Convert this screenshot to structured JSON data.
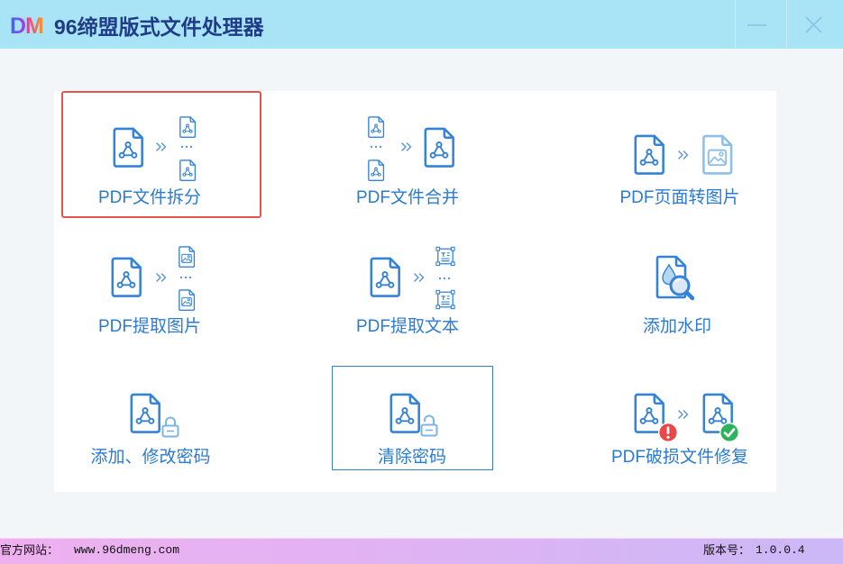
{
  "app": {
    "logo_text": "DM",
    "title": "96缔盟版式文件处理器"
  },
  "window_controls": {
    "minimize": "minimize-icon",
    "close": "close-icon"
  },
  "tools": [
    {
      "label": "PDF文件拆分",
      "icons": [
        "pdf-icon",
        "double-chevron-right-icon",
        "pdf-small-icon",
        "ellipsis-icon",
        "pdf-small-icon"
      ]
    },
    {
      "label": "PDF文件合并",
      "icons": [
        "pdf-small-icon",
        "ellipsis-icon",
        "pdf-small-icon",
        "double-chevron-right-icon",
        "pdf-icon"
      ]
    },
    {
      "label": "PDF页面转图片",
      "icons": [
        "pdf-icon",
        "double-chevron-right-icon",
        "image-file-icon"
      ]
    },
    {
      "label": "PDF提取图片",
      "icons": [
        "pdf-icon",
        "double-chevron-right-icon",
        "image-file-small-icon",
        "ellipsis-icon",
        "image-file-small-icon"
      ]
    },
    {
      "label": "PDF提取文本",
      "icons": [
        "pdf-icon",
        "double-chevron-right-icon",
        "text-block-icon",
        "ellipsis-icon",
        "text-block-icon"
      ]
    },
    {
      "label": "添加水印",
      "icons": [
        "watermark-magnifier-icon"
      ]
    },
    {
      "label": "添加、修改密码",
      "icons": [
        "pdf-icon",
        "lock-icon"
      ]
    },
    {
      "label": "清除密码",
      "icons": [
        "pdf-icon",
        "unlock-icon"
      ]
    },
    {
      "label": "PDF破损文件修复",
      "icons": [
        "pdf-icon",
        "error-badge-icon",
        "double-chevron-right-icon",
        "pdf-icon",
        "success-badge-icon"
      ]
    }
  ],
  "ui_state": {
    "selected_tool": 0,
    "hovered_tool": 7
  },
  "status_bar": {
    "website_label": "官方网站：",
    "website_url": "www.96dmeng.com",
    "version_label": "版本号：",
    "version": "1.0.0.4"
  },
  "colors": {
    "title_bar_bg": "#a8e3f6",
    "main_bg": "#f3f6f9",
    "panel_bg": "#ffffff",
    "title_text": "#1f3c88",
    "label_blue": "#2b7bd2",
    "icon_blue": "#3583d6",
    "icon_light": "#8dbfe9",
    "lock_blue": "#7db4e7",
    "chevron_blue": "#5a97d7",
    "window_icon": "#86c5e6",
    "selected_border": "#e5534f",
    "hover_border": "#3a7fc6",
    "error_red": "#e84848",
    "success_green": "#2db35c",
    "status_bar_left": "#efb0ef",
    "status_bar_right": "#cbb8f6"
  }
}
